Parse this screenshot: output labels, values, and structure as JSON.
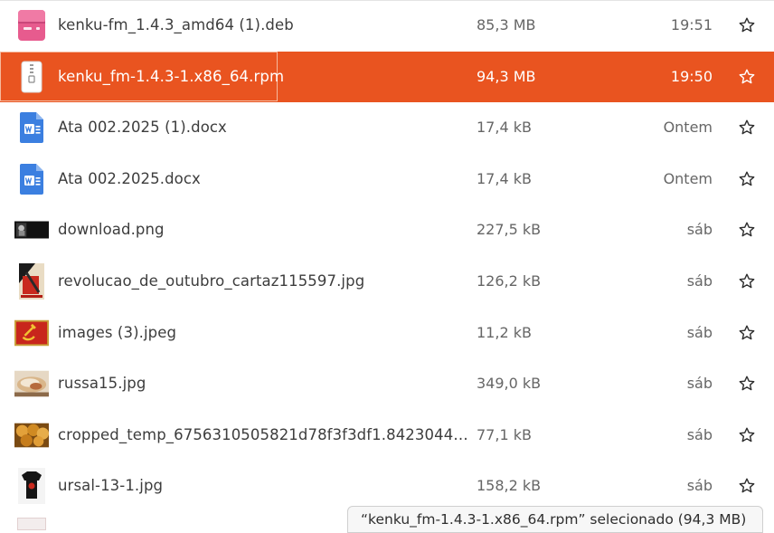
{
  "files": [
    {
      "name": "kenku-fm_1.4.3_amd64 (1).deb",
      "size": "85,3 MB",
      "modified": "19:51",
      "icon": "deb-package-icon",
      "selected": false
    },
    {
      "name": "kenku_fm-1.4.3-1.x86_64.rpm",
      "size": "94,3 MB",
      "modified": "19:50",
      "icon": "archive-zipper-icon",
      "selected": true
    },
    {
      "name": "Ata 002.2025 (1).docx",
      "size": "17,4 kB",
      "modified": "Ontem",
      "icon": "word-document-icon",
      "selected": false
    },
    {
      "name": "Ata 002.2025.docx",
      "size": "17,4 kB",
      "modified": "Ontem",
      "icon": "word-document-icon",
      "selected": false
    },
    {
      "name": "download.png",
      "size": "227,5 kB",
      "modified": "sáb",
      "icon": "image-thumbnail-icon",
      "selected": false
    },
    {
      "name": "revolucao_de_outubro_cartaz115597.jpg",
      "size": "126,2 kB",
      "modified": "sáb",
      "icon": "image-thumbnail-icon",
      "selected": false
    },
    {
      "name": "images (3).jpeg",
      "size": "11,2 kB",
      "modified": "sáb",
      "icon": "image-thumbnail-icon",
      "selected": false
    },
    {
      "name": "russa15.jpg",
      "size": "349,0 kB",
      "modified": "sáb",
      "icon": "image-thumbnail-icon",
      "selected": false
    },
    {
      "name": "cropped_temp_6756310505821d78f3f3df1.8423044…",
      "size": "77,1 kB",
      "modified": "sáb",
      "icon": "image-thumbnail-icon",
      "selected": false
    },
    {
      "name": "ursal-13-1.jpg",
      "size": "158,2 kB",
      "modified": "sáb",
      "icon": "image-thumbnail-icon",
      "selected": false
    }
  ],
  "statusbar": {
    "text": "“kenku_fm-1.4.3-1.x86_64.rpm” selecionado  (94,3 MB)"
  },
  "colors": {
    "selection": "#e95420",
    "text": "#3d3d3d",
    "secondary_text": "#666666"
  }
}
